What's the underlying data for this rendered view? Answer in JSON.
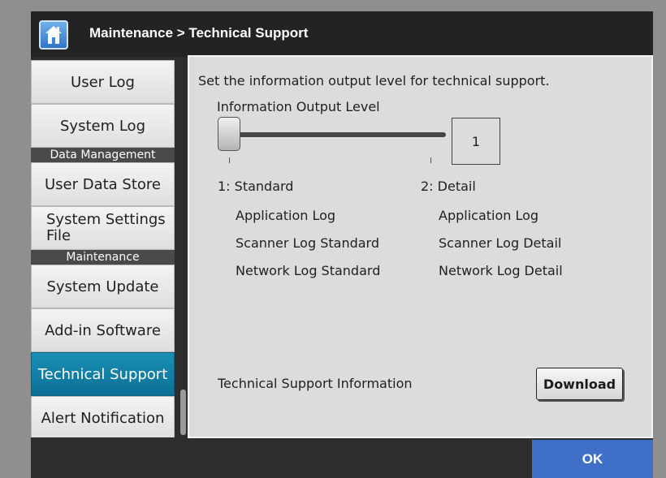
{
  "header": {
    "home_icon": "home-icon",
    "breadcrumb": "Maintenance > Technical Support"
  },
  "sidebar": {
    "items": [
      {
        "label": "User Log"
      },
      {
        "label": "System Log"
      },
      {
        "section": "Data Management"
      },
      {
        "label": "User Data Store"
      },
      {
        "label_line1": "System Settings",
        "label_line2": "File"
      },
      {
        "section": "Maintenance"
      },
      {
        "label": "System Update"
      },
      {
        "label": "Add-in Software"
      },
      {
        "label": "Technical Support",
        "selected": true
      },
      {
        "label": "Alert Notification"
      }
    ]
  },
  "main": {
    "description": "Set the information output level for technical support.",
    "output_level": {
      "label": "Information Output Level",
      "value": "1",
      "min": 1,
      "max": 2
    },
    "levels": {
      "standard": {
        "title": "1: Standard",
        "items": [
          "Application Log",
          "Scanner Log Standard",
          "Network Log Standard"
        ]
      },
      "detail": {
        "title": "2: Detail",
        "items": [
          "Application Log",
          "Scanner Log Detail",
          "Network Log Detail"
        ]
      }
    },
    "tech_info_label": "Technical Support Information",
    "download_label": "Download"
  },
  "footer": {
    "ok_label": "OK"
  },
  "colors": {
    "selected_item": "#1b8fb5",
    "ok_button": "#3f6fc6"
  }
}
